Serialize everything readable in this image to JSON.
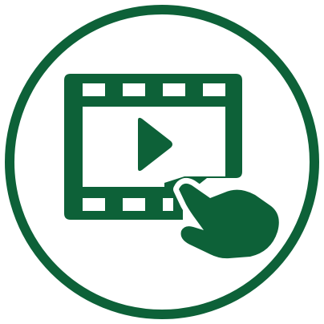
{
  "icon": {
    "name": "video-film-tap-icon",
    "color": "#0d6138",
    "background": "#ffffff"
  }
}
